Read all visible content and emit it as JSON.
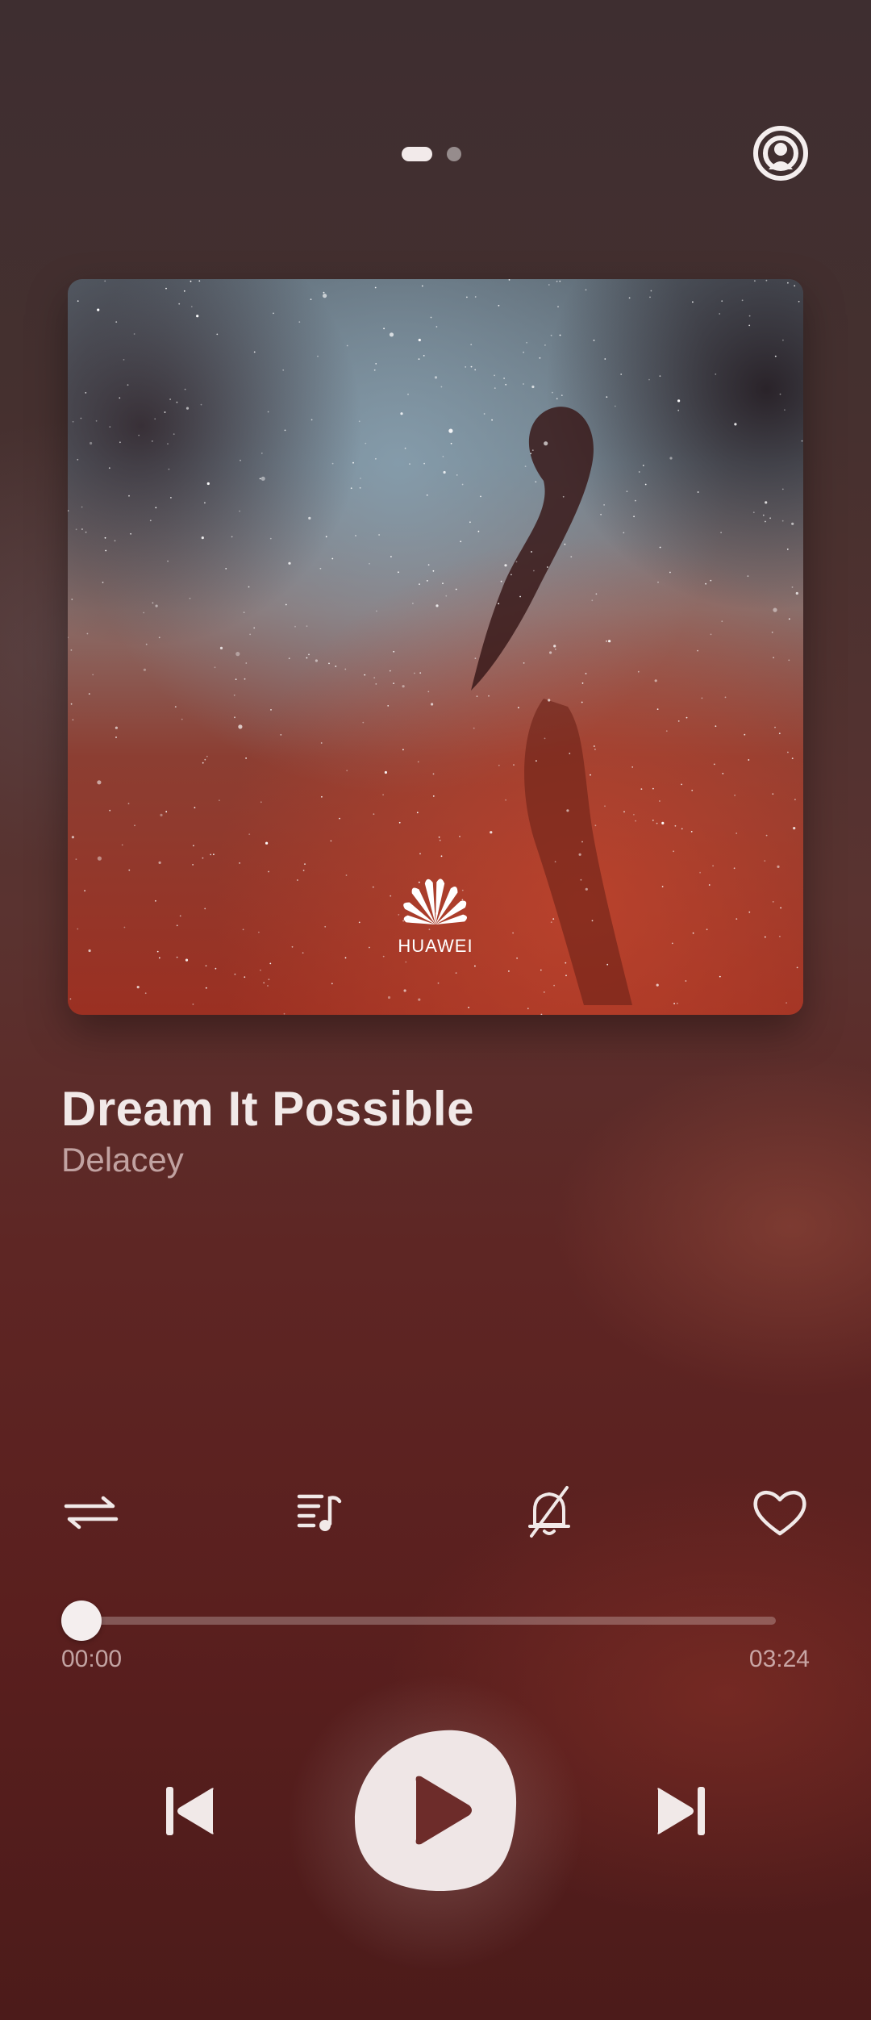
{
  "header": {
    "pages": 2,
    "active_page": 1,
    "cast_icon": "cast-person-icon"
  },
  "album": {
    "cover_description_icon": "nebula-cover",
    "logo_text": "HUAWEI"
  },
  "track": {
    "title": "Dream It Possible",
    "artist": "Delacey"
  },
  "actions": {
    "repeat_icon": "repeat-icon",
    "lyrics_icon": "playlist-music-icon",
    "ringtone_icon": "bell-off-icon",
    "favorite_icon": "heart-icon"
  },
  "progress": {
    "elapsed": "00:00",
    "duration": "03:24",
    "fraction": 0.0
  },
  "playback": {
    "prev_icon": "skip-previous-icon",
    "play_icon": "play-icon",
    "next_icon": "skip-next-icon"
  },
  "colors": {
    "accent": "#f2eaea",
    "background_top": "#3e2e30",
    "background_bottom": "#4c1b1a"
  }
}
